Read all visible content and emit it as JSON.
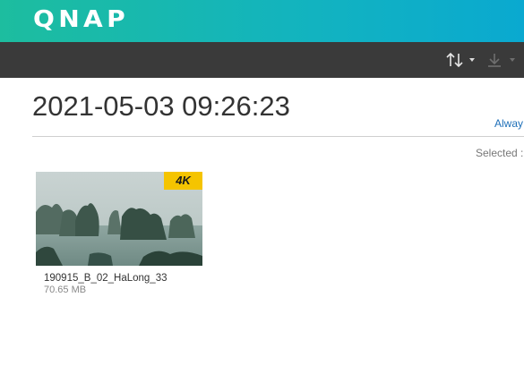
{
  "header": {
    "logo_text": "QNAP",
    "brand_colors": [
      "#1dbd9f",
      "#0aa9d0"
    ]
  },
  "toolbar": {
    "sort_icon": "sort-arrows-icon",
    "download_icon": "download-icon",
    "background": "#3a3a3a"
  },
  "main": {
    "title": "2021-05-03 09:26:23",
    "always_link": "Alway",
    "selected_label": "Selected :"
  },
  "files": [
    {
      "name": "190915_B_02_HaLong_33",
      "size": "70.65 MB",
      "badge": "4K",
      "badge_color": "#f5c400"
    }
  ]
}
